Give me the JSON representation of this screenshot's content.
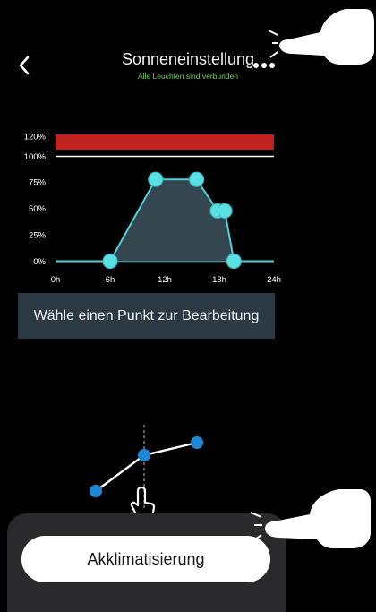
{
  "header": {
    "title": "Sonneneinstellung",
    "subtitle": "Alle Leuchten sind verbunden",
    "subtitle_color": "#6bcf54",
    "back_icon": "chevron-left-icon",
    "more_icon": "more-dots-icon"
  },
  "chart_data": {
    "type": "area",
    "xlabel": "",
    "ylabel": "",
    "x_ticks": [
      "0h",
      "6h",
      "12h",
      "18h",
      "24h"
    ],
    "y_ticks": [
      "0%",
      "25%",
      "50%",
      "75%",
      "100%",
      "120%"
    ],
    "xlim": [
      0,
      24
    ],
    "ylim": [
      0,
      120
    ],
    "overlimit_band": [
      100,
      120
    ],
    "x": [
      0,
      6,
      11,
      15.5,
      17.8,
      18.6,
      19.6,
      24
    ],
    "y": [
      0,
      0,
      78,
      78,
      48,
      48,
      0,
      0
    ],
    "control_points": [
      {
        "x": 6,
        "y": 0
      },
      {
        "x": 11,
        "y": 78
      },
      {
        "x": 15.5,
        "y": 78
      },
      {
        "x": 17.8,
        "y": 48
      },
      {
        "x": 18.6,
        "y": 48
      },
      {
        "x": 19.6,
        "y": 0
      }
    ],
    "line_color": "#4fd0dc",
    "point_color": "#59e0e3",
    "fill_color": "#34474f",
    "band_color": "#c0231f",
    "grid": false
  },
  "edit_prompt": "Wähle einen Punkt zur Bearbeitung",
  "acclimatize_button": "Akklimatisierung",
  "illustration": {
    "line_icon": "line-graph-icon",
    "tap_icon": "tap-hand-icon",
    "point_color": "#1e88d6"
  },
  "hints": {
    "icon": "pointing-hand-icon"
  }
}
